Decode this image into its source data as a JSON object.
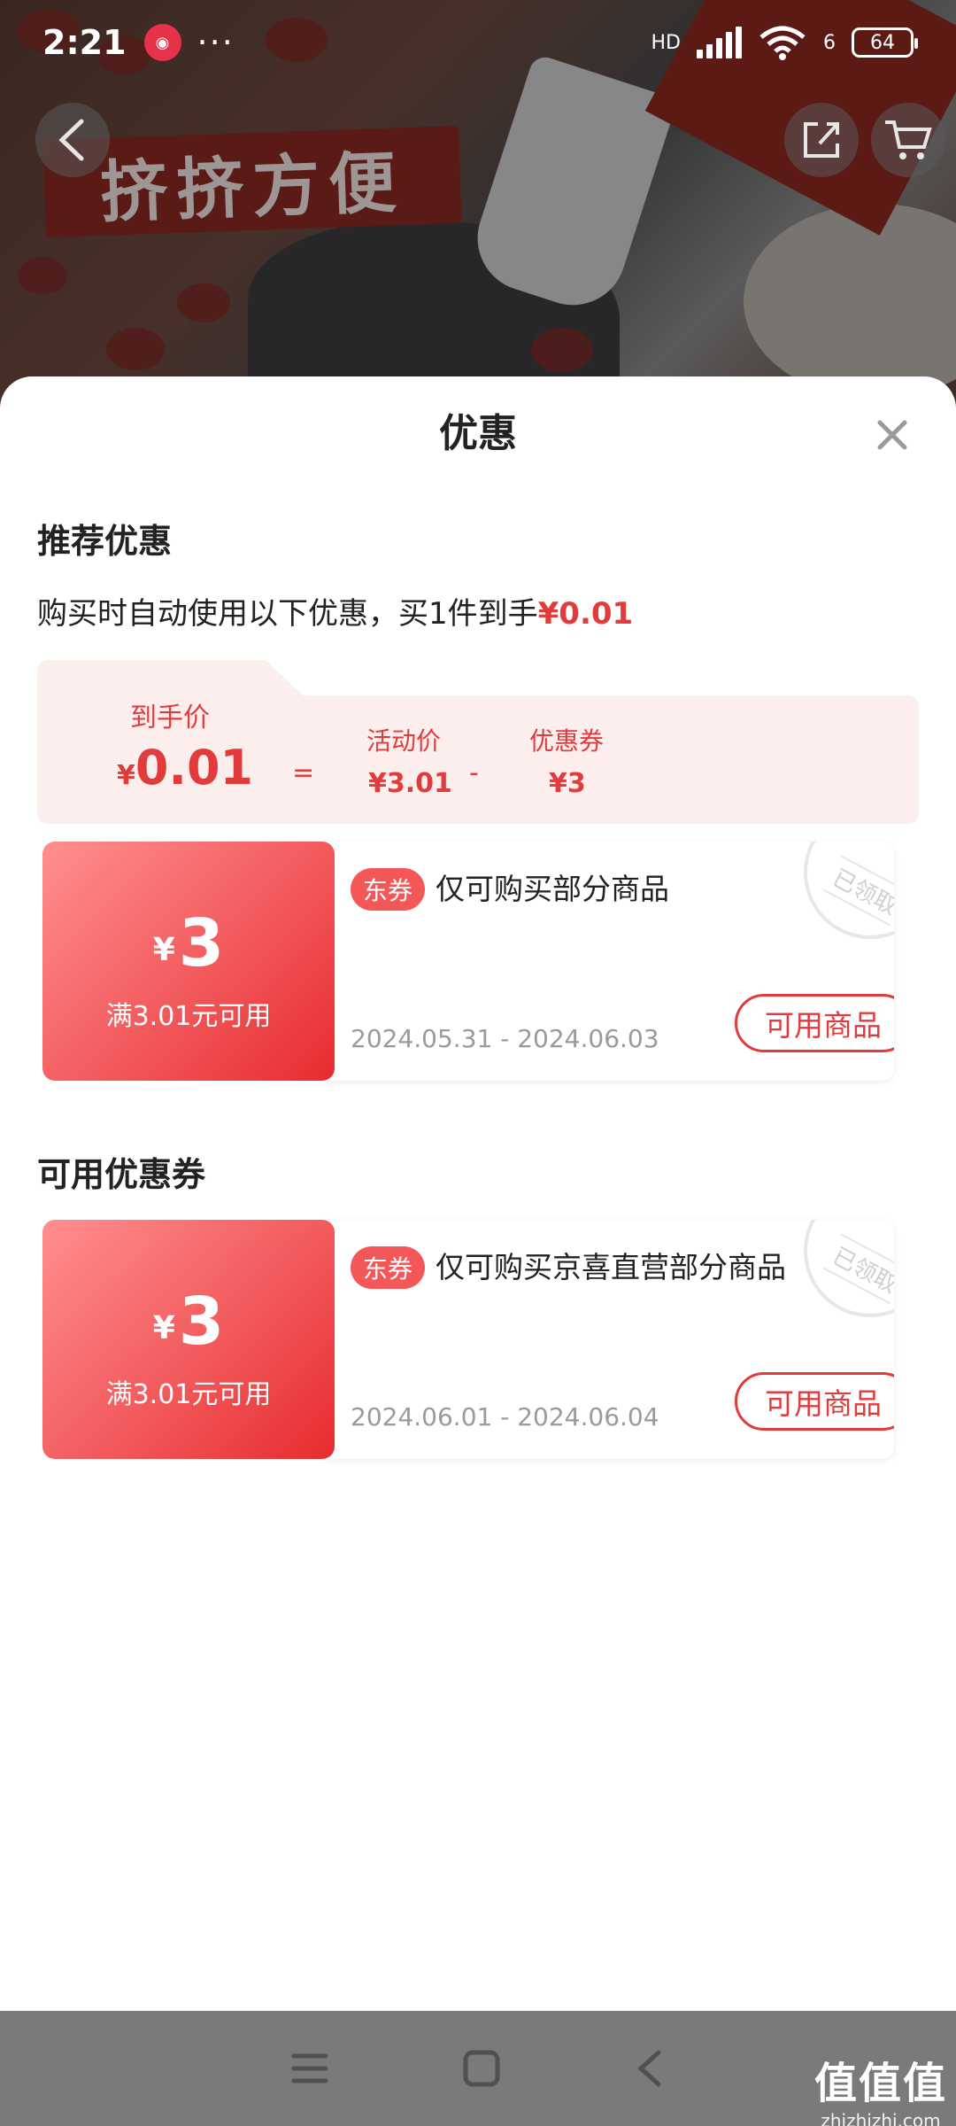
{
  "status_bar": {
    "time": "2:21",
    "dots": "···",
    "hd": "HD",
    "wifi_level": "6",
    "battery": "64"
  },
  "banner": {
    "slogan": "挤挤方便"
  },
  "sheet": {
    "title": "优惠",
    "recommended_title": "推荐优惠",
    "auto_note_prefix": "购买时自动使用以下优惠，买1件到手",
    "auto_note_final": "¥0.01",
    "breakdown": {
      "final_label": "到手价",
      "final_yen": "¥",
      "final_value": "0.01",
      "equals": "=",
      "activity_label": "活动价",
      "activity_value": "¥3.01",
      "minus": "-",
      "coupon_label": "优惠券",
      "coupon_value": "¥3"
    },
    "available_title": "可用优惠券",
    "coupons": [
      {
        "yen": "¥",
        "amount": "3",
        "condition": "满3.01元可用",
        "tag": "东券",
        "description": "仅可购买部分商品",
        "date": "2024.05.31 - 2024.06.03",
        "button": "可用商品",
        "stamp": "已领取"
      },
      {
        "yen": "¥",
        "amount": "3",
        "condition": "满3.01元可用",
        "tag": "东券",
        "description": "仅可购买京喜直营部分商品",
        "date": "2024.06.01 - 2024.06.04",
        "button": "可用商品",
        "stamp": "已领取"
      }
    ]
  },
  "watermark": {
    "title": "值值值",
    "url": "zhizhizhi.com"
  },
  "colors": {
    "accent_red": "#e23b3b",
    "breakdown_bg": "#fdeeee"
  },
  "icons": [
    "back-icon",
    "share-icon",
    "cart-icon",
    "close-icon",
    "menu-icon",
    "home-icon",
    "nav-back-icon"
  ]
}
